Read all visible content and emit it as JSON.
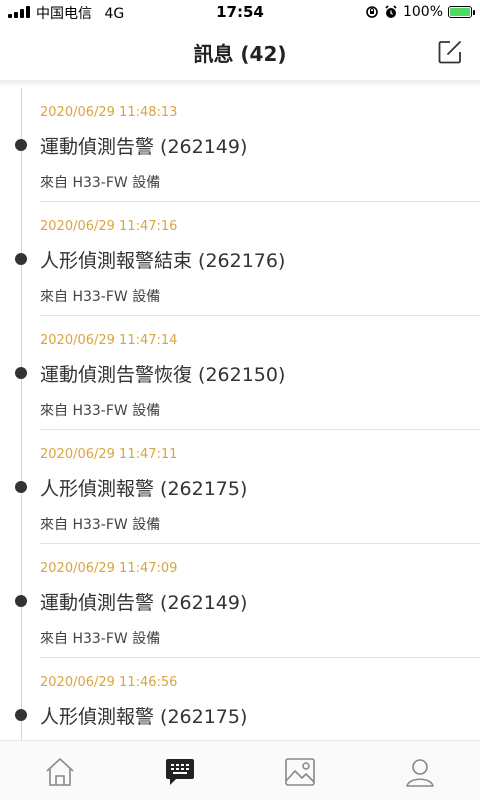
{
  "status_bar": {
    "carrier": "中国电信",
    "network": "4G",
    "time": "17:54",
    "battery": "100%",
    "battery_color": "#4cd964"
  },
  "header": {
    "title": "訊息 (42)",
    "compose_icon": "compose-icon"
  },
  "messages": [
    {
      "timestamp": "2020/06/29 11:48:13",
      "title": "運動偵測告警 (262149)",
      "source": "來自 H33-FW  設備"
    },
    {
      "timestamp": "2020/06/29 11:47:16",
      "title": "人形偵測報警結束 (262176)",
      "source": "來自 H33-FW  設備"
    },
    {
      "timestamp": "2020/06/29 11:47:14",
      "title": "運動偵測告警恢復 (262150)",
      "source": "來自 H33-FW  設備"
    },
    {
      "timestamp": "2020/06/29 11:47:11",
      "title": "人形偵測報警 (262175)",
      "source": "來自 H33-FW  設備"
    },
    {
      "timestamp": "2020/06/29 11:47:09",
      "title": "運動偵測告警 (262149)",
      "source": "來自 H33-FW  設備"
    },
    {
      "timestamp": "2020/06/29 11:46:56",
      "title": "人形偵測報警 (262175)",
      "source": ""
    }
  ],
  "tabbar": {
    "tabs": [
      {
        "icon": "home-icon",
        "active": false
      },
      {
        "icon": "message-icon",
        "active": true
      },
      {
        "icon": "image-icon",
        "active": false
      },
      {
        "icon": "profile-icon",
        "active": false
      }
    ]
  },
  "colors": {
    "timestamp": "#d9a441",
    "dot": "#333333"
  }
}
